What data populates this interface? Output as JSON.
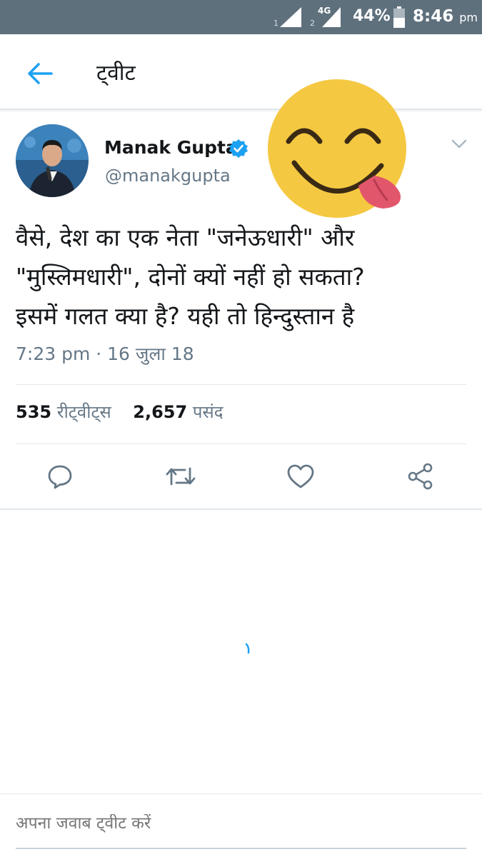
{
  "status_bar": {
    "sim1": "1",
    "sim2": "2",
    "network": "4G",
    "battery": "44%",
    "time": "8:46",
    "ampm": "pm"
  },
  "header": {
    "back_icon": "arrow-left-icon",
    "title": "ट्वीट"
  },
  "tweet": {
    "author_name": "Manak Gupta",
    "handle": "@manakgupta",
    "verified_icon": "verified-badge-icon",
    "text_lines": [
      "वैसे, देश का एक नेता \"जनेऊधारी\" और",
      "\"मुस्लिमधारी\", दोनों क्यों नहीं हो सकता?",
      "इसमें गलत क्या है? यही तो हिन्दुस्तान है"
    ],
    "timestamp": "7:23 pm · 16 जुला 18"
  },
  "stats": {
    "retweets_count": "535",
    "retweets_label": "रीट्वीट्स",
    "likes_count": "2,657",
    "likes_label": "पसंद"
  },
  "actions": [
    "reply-icon",
    "retweet-icon",
    "like-icon",
    "share-icon"
  ],
  "reply": {
    "placeholder": "अपना जवाब ट्वीट करें"
  },
  "colors": {
    "status_bar": "#5f707d",
    "accent": "#1da1f2",
    "secondary_text": "#657786",
    "emoji_face": "#f5c842",
    "emoji_tongue": "#e2566b"
  }
}
